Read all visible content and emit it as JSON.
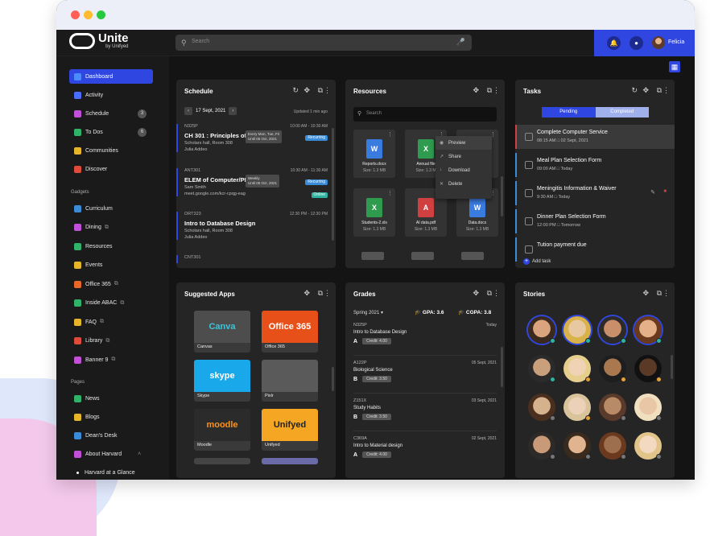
{
  "app": {
    "name": "Unite",
    "by": "by Unifyed"
  },
  "search": {
    "placeholder": "Search"
  },
  "user": {
    "name": "Felicia"
  },
  "sidebar": {
    "items": [
      {
        "label": "Dashboard",
        "color": "#4a8cff"
      },
      {
        "label": "Activity",
        "color": "#4a6cff"
      },
      {
        "label": "Schedule",
        "color": "#c24fd8",
        "badge": "3"
      },
      {
        "label": "To Dos",
        "color": "#2fb36b",
        "badge": "6"
      },
      {
        "label": "Communities",
        "color": "#e6b52a"
      },
      {
        "label": "Discover",
        "color": "#e04a3a"
      }
    ],
    "gadgets_heading": "Gadgets",
    "gadgets": [
      {
        "label": "Curriculum",
        "color": "#3a8bd8"
      },
      {
        "label": "Dining",
        "color": "#c24fd8",
        "ext": true
      },
      {
        "label": "Resources",
        "color": "#2fb36b"
      },
      {
        "label": "Events",
        "color": "#e6b52a"
      },
      {
        "label": "Office 365",
        "color": "#e8662a",
        "ext": true
      },
      {
        "label": "Inside ABAC",
        "color": "#2fb36b",
        "ext": true
      },
      {
        "label": "FAQ",
        "color": "#e6b52a",
        "ext": true
      },
      {
        "label": "Library",
        "color": "#e04a3a",
        "ext": true
      },
      {
        "label": "Banner 9",
        "color": "#c24fd8",
        "ext": true
      }
    ],
    "pages_heading": "Pages",
    "pages": [
      {
        "label": "News",
        "color": "#2fb36b"
      },
      {
        "label": "Blogs",
        "color": "#e6b52a"
      },
      {
        "label": "Dean's Desk",
        "color": "#3a8bd8"
      },
      {
        "label": "About Harvard",
        "color": "#c24fd8"
      },
      {
        "label": "Harvard at a Glance",
        "color": "#ffffff"
      }
    ]
  },
  "schedule": {
    "title": "Schedule",
    "date": "17 Sept, 2021",
    "updated": "Updated 1 min ago",
    "items": [
      {
        "code": "N325P",
        "title": "CH 301 : Principles of Ch",
        "time": "10:00 AM - 10:30 AM",
        "meta1": "Scholars hall, Room 308",
        "meta2": "Julia Addeo",
        "tag": "Recurring",
        "tag_color": "#3a8bd8",
        "tip": "Every Mon, Tue, Fri\nUntil 05 Oct, 2021"
      },
      {
        "code": "ANT301",
        "title": "ELEM of Computer/PROG",
        "time": "10:30 AM - 11:30 AM",
        "meta1": "Sam Smith",
        "meta2": "meet.google.com/kcr-cpqg-eag",
        "tag": "Recurring",
        "tag_color": "#3a8bd8",
        "tag2": "Online",
        "tag2_color": "#2fb3a0",
        "tip": "Weekly\nUntil 05 Oct, 2021"
      },
      {
        "code": "ORT323",
        "title": "Intro to Database Design",
        "time": "12:30 PM - 12:30 PM",
        "meta1": "Scholars hall, Room 308",
        "meta2": "Julia Addeo"
      },
      {
        "code": "CNT301",
        "title": "",
        "time": "",
        "meta1": "",
        "meta2": ""
      }
    ]
  },
  "resources": {
    "title": "Resources",
    "search_placeholder": "Search",
    "files": [
      {
        "name": "Reports.docx",
        "size": "Size: 1.3 MB",
        "type": "W",
        "color": "#3a7be0"
      },
      {
        "name": "Annual file",
        "size": "Size: 1.3 M",
        "type": "X",
        "color": "#2f9b4e"
      },
      {
        "name": "",
        "size": "",
        "type": "",
        "color": "#d04040"
      },
      {
        "name": "Students-2.xls",
        "size": "Size: 1.3 MB",
        "type": "X",
        "color": "#2f9b4e"
      },
      {
        "name": "AI data.pdf",
        "size": "Size: 1.3 MB",
        "type": "A",
        "color": "#d04040"
      },
      {
        "name": "Data.docx",
        "size": "Size: 1.3 MB",
        "type": "W",
        "color": "#3a7be0"
      }
    ],
    "menu": [
      "Preview",
      "Share",
      "Download",
      "Delete"
    ]
  },
  "tasks": {
    "title": "Tasks",
    "tab_pending": "Pending",
    "tab_completed": "Completed",
    "items": [
      {
        "title": "Complete Computer Service",
        "time": "08:15 AM",
        "date": "02 Sept, 2021"
      },
      {
        "title": "Meal Plan Selection Form",
        "time": "09:00 AM",
        "date": "Today"
      },
      {
        "title": "Meningitis Information & Waiver",
        "time": "9:30 AM",
        "date": "Today"
      },
      {
        "title": "Dinner Plan Selection Form",
        "time": "12:00 PM",
        "date": "Tomorrow"
      },
      {
        "title": "Tution payment due",
        "time": "",
        "date": ""
      }
    ],
    "add": "Add task"
  },
  "apps": {
    "title": "Suggested Apps",
    "items": [
      {
        "label": "Canvas",
        "bg": "#4d4d4d",
        "logo": "Canva",
        "logo_color": "#3fc3d8"
      },
      {
        "label": "Office 365",
        "bg": "#e8501a",
        "logo": "Office 365",
        "logo_color": "#ffffff"
      },
      {
        "label": "Skype",
        "bg": "#19a8ea",
        "logo": "skype",
        "logo_color": "#ffffff"
      },
      {
        "label": "Pixlr",
        "bg": "#5a5a5a",
        "logo": "",
        "logo_color": "#ffffff"
      },
      {
        "label": "Moodle",
        "bg": "#2b2b2b",
        "logo": "moodle",
        "logo_color": "#f7931e"
      },
      {
        "label": "Unifyed",
        "bg": "#f5a623",
        "logo": "Unifyed",
        "logo_color": "#222222"
      }
    ]
  },
  "grades": {
    "title": "Grades",
    "term": "Spring 2021",
    "gpa": "GPA: 3.6",
    "cgpa": "CGPA: 3.8",
    "items": [
      {
        "code": "N325P",
        "course": "Intro to Database Design",
        "date": "Today",
        "grade": "A",
        "credit": "Credit: 4.00"
      },
      {
        "code": "A122P",
        "course": "Biological Science",
        "date": "05 Sept, 2021",
        "grade": "B",
        "credit": "Credit: 3.50"
      },
      {
        "code": "Z151X",
        "course": "Study Habits",
        "date": "03 Sept, 2021",
        "grade": "B",
        "credit": "Credit: 3.50"
      },
      {
        "code": "C369A",
        "course": "Intro to Material design",
        "date": "02 Sept, 2021",
        "grade": "A",
        "credit": "Credit: 4.00"
      }
    ]
  },
  "stories": {
    "title": "Stories"
  }
}
